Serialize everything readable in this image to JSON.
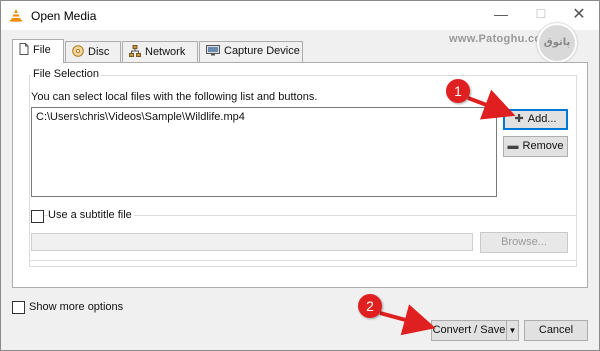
{
  "window": {
    "title": "Open Media",
    "minimize_glyph": "—",
    "maximize_glyph": "☐",
    "close_glyph": "✕"
  },
  "watermark": {
    "text": "www.Patoghu.com",
    "logo_text": "پاتوق"
  },
  "tabs": [
    {
      "label": "File",
      "icon": "file-icon",
      "active": true
    },
    {
      "label": "Disc",
      "icon": "disc-icon",
      "active": false
    },
    {
      "label": "Network",
      "icon": "network-icon",
      "active": false
    },
    {
      "label": "Capture Device",
      "icon": "capture-device-icon",
      "active": false
    }
  ],
  "file_selection": {
    "legend": "File Selection",
    "description": "You can select local files with the following list and buttons.",
    "files": [
      "C:\\Users\\chris\\Videos\\Sample\\Wildlife.mp4"
    ],
    "add_label": "Add...",
    "remove_label": "Remove"
  },
  "subtitle": {
    "checkbox_label": "Use a subtitle file",
    "checked": false,
    "path_value": "",
    "browse_label": "Browse..."
  },
  "footer": {
    "show_more_label": "Show more options",
    "convert_label": "Convert / Save",
    "dropdown_glyph": "▼",
    "cancel_label": "Cancel"
  },
  "annotations": [
    {
      "number": "1",
      "color": "#e02020"
    },
    {
      "number": "2",
      "color": "#e02020"
    }
  ],
  "colors": {
    "accent": "#0078d7",
    "vlc_orange": "#f08a00",
    "annotation_red": "#e02020"
  }
}
